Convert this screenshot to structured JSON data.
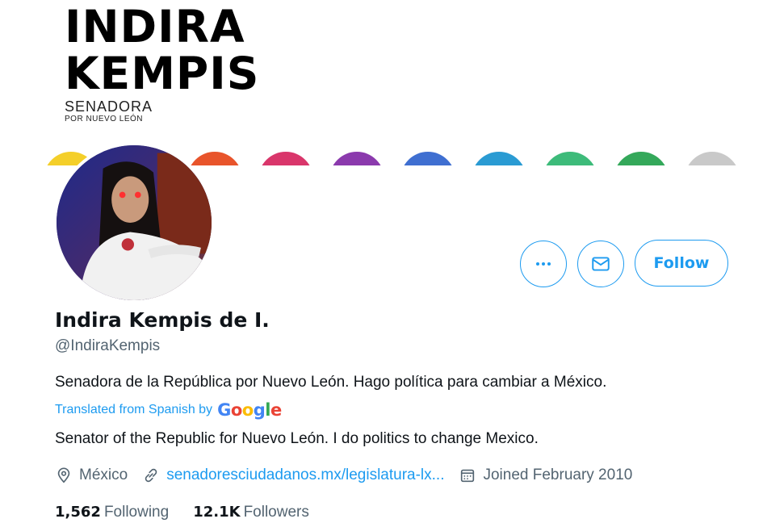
{
  "banner": {
    "logo_line1": "INDIRA",
    "logo_line2": "KEMPIS",
    "logo_sub1": "SENADORA",
    "logo_sub2": "POR NUEVO LEÓN",
    "icons": [
      {
        "name": "sneaker-icon",
        "color": "#e8542b"
      },
      {
        "name": "people-heart-icon",
        "color": "#d9366b"
      },
      {
        "name": "raised-fist-icon",
        "color": "#8b3aad"
      },
      {
        "name": "blocks-icon",
        "color": "#3f6fd1"
      },
      {
        "name": "water-drops-icon",
        "color": "#2a9bd3"
      },
      {
        "name": "circle-of-people-icon",
        "color": "#3dbb7a"
      },
      {
        "name": "head-icon",
        "color": "#34a85a"
      },
      {
        "name": "buildings-icon",
        "color": "#c9c9c9"
      }
    ]
  },
  "profile": {
    "name": "Indira Kempis de I.",
    "handle": "@IndiraKempis",
    "bio": "Senadora de la República por Nuevo León. Hago política para cambiar a México.",
    "translated_label": "Translated from Spanish by",
    "translated_provider": "Google",
    "bio_translation": "Senator of the Republic for Nuevo León. I do politics to change Mexico.",
    "location": "México",
    "website": "senadoresciudadanos.mx/legislatura-lx...",
    "joined": "Joined February 2010",
    "following_count": "1,562",
    "following_label": "Following",
    "followers_count": "12.1K",
    "followers_label": "Followers"
  },
  "actions": {
    "more_icon": "more-icon",
    "message_icon": "mail-icon",
    "follow_label": "Follow"
  },
  "colors": {
    "accent": "#1d9bf0",
    "secondary_text": "#536471",
    "primary_text": "#0f1419"
  }
}
